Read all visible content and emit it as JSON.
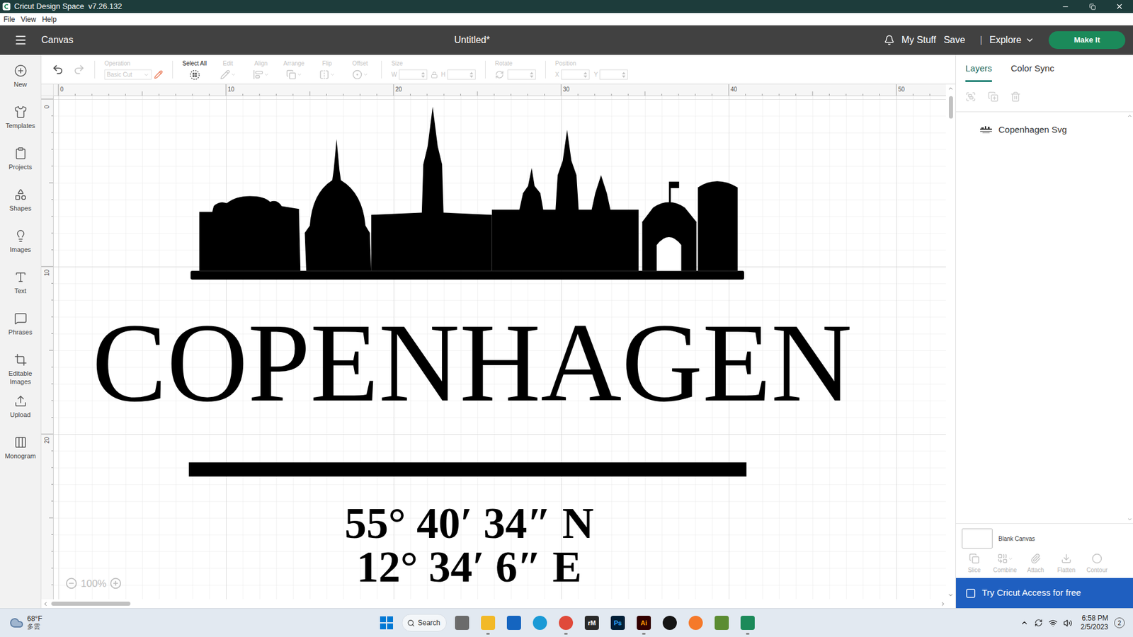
{
  "window": {
    "title": "Cricut Design Space  v7.26.132"
  },
  "menu": [
    "File",
    "View",
    "Help"
  ],
  "header": {
    "section": "Canvas",
    "document": "Untitled*",
    "links": [
      "My Stuff",
      "Save"
    ],
    "separator": "|",
    "explore": "Explore",
    "make_it": "Make It"
  },
  "toolbar": {
    "undo_enabled": true,
    "redo_enabled": false,
    "operation": {
      "label": "Operation",
      "value": "Basic Cut",
      "disabled": true
    },
    "tools": [
      {
        "label": "Select All",
        "disabled": false,
        "dropdown": false
      },
      {
        "label": "Edit",
        "disabled": true,
        "dropdown": true
      },
      {
        "label": "Align",
        "disabled": true,
        "dropdown": true
      },
      {
        "label": "Arrange",
        "disabled": true,
        "dropdown": true
      },
      {
        "label": "Flip",
        "disabled": true,
        "dropdown": true
      },
      {
        "label": "Offset",
        "disabled": true,
        "dropdown": true
      }
    ],
    "size": {
      "label": "Size",
      "fields": [
        "W",
        "H"
      ],
      "disabled": true
    },
    "rotate": {
      "label": "Rotate",
      "disabled": true
    },
    "position": {
      "label": "Position",
      "fields": [
        "X",
        "Y"
      ],
      "disabled": true
    }
  },
  "sidebar": {
    "items": [
      {
        "label": "New"
      },
      {
        "label": "Templates"
      },
      {
        "label": "Projects"
      },
      {
        "label": "Shapes"
      },
      {
        "label": "Images"
      },
      {
        "label": "Text"
      },
      {
        "label": "Phrases"
      },
      {
        "label": "Editable Images"
      },
      {
        "label": "Upload"
      },
      {
        "label": "Monogram"
      }
    ]
  },
  "canvas": {
    "ruler_x": [
      "0",
      "10",
      "20",
      "30",
      "40",
      "50"
    ],
    "ruler_y": [
      "0",
      "10",
      "20"
    ],
    "title": "COPENHAGEN",
    "coordinates": [
      "55° 40′ 34″ N",
      "12° 34′ 6″ E"
    ],
    "zoom": "100%"
  },
  "layers_panel": {
    "tabs": [
      {
        "label": "Layers",
        "selected": true
      },
      {
        "label": "Color Sync",
        "selected": false
      }
    ],
    "layer_tools": [
      {
        "disabled": true
      },
      {
        "disabled": true
      },
      {
        "disabled": true
      }
    ],
    "layers": [
      {
        "name": "Copenhagen Svg",
        "selected": false
      }
    ],
    "canvas_label": "Blank Canvas",
    "actions": [
      {
        "label": "Slice",
        "disabled": true,
        "dropdown": false
      },
      {
        "label": "Combine",
        "disabled": true,
        "dropdown": true
      },
      {
        "label": "Attach",
        "disabled": true,
        "dropdown": false
      },
      {
        "label": "Flatten",
        "disabled": true,
        "dropdown": false
      },
      {
        "label": "Contour",
        "disabled": true,
        "dropdown": false
      }
    ],
    "banner": "Try Cricut Access for free"
  },
  "taskbar": {
    "weather": {
      "temp": "68°F",
      "condition": "多雲"
    },
    "search": "Search",
    "apps": [
      {
        "kind": "windows",
        "glyph": "",
        "color": "#0078d4",
        "text_color": "#ffffff",
        "running": false
      },
      {
        "kind": "tile",
        "glyph": "",
        "color": "#6b6b6b",
        "text_color": "#ffffff",
        "running": false
      },
      {
        "kind": "tile",
        "glyph": "",
        "color": "#f2b928",
        "text_color": "#ffffff",
        "running": true
      },
      {
        "kind": "tile",
        "glyph": "",
        "color": "#1565c0",
        "text_color": "#ffffff",
        "running": false
      },
      {
        "kind": "round",
        "glyph": "",
        "color": "#1a9ad6",
        "text_color": "#ffffff",
        "running": false
      },
      {
        "kind": "round",
        "glyph": "",
        "color": "#e04a3a",
        "text_color": "#ffffff",
        "running": true
      },
      {
        "kind": "tile",
        "glyph": "rM",
        "color": "#2a2a2a",
        "text_color": "#ffffff",
        "running": false
      },
      {
        "kind": "tile",
        "glyph": "Ps",
        "color": "#001e36",
        "text_color": "#31a8ff",
        "running": false
      },
      {
        "kind": "tile",
        "glyph": "Ai",
        "color": "#330000",
        "text_color": "#ff9a00",
        "running": true
      },
      {
        "kind": "round",
        "glyph": "",
        "color": "#151515",
        "text_color": "#ffffff",
        "running": false
      },
      {
        "kind": "round",
        "glyph": "",
        "color": "#f5792a",
        "text_color": "#ffffff",
        "running": false
      },
      {
        "kind": "tile",
        "glyph": "",
        "color": "#5b8c32",
        "text_color": "#ffffff",
        "running": false
      },
      {
        "kind": "tile",
        "glyph": "",
        "color": "#1c8a5a",
        "text_color": "#ffffff",
        "running": true
      }
    ],
    "clock": {
      "time": "6:58 PM",
      "date": "2/5/2023"
    },
    "notifications": "2"
  }
}
